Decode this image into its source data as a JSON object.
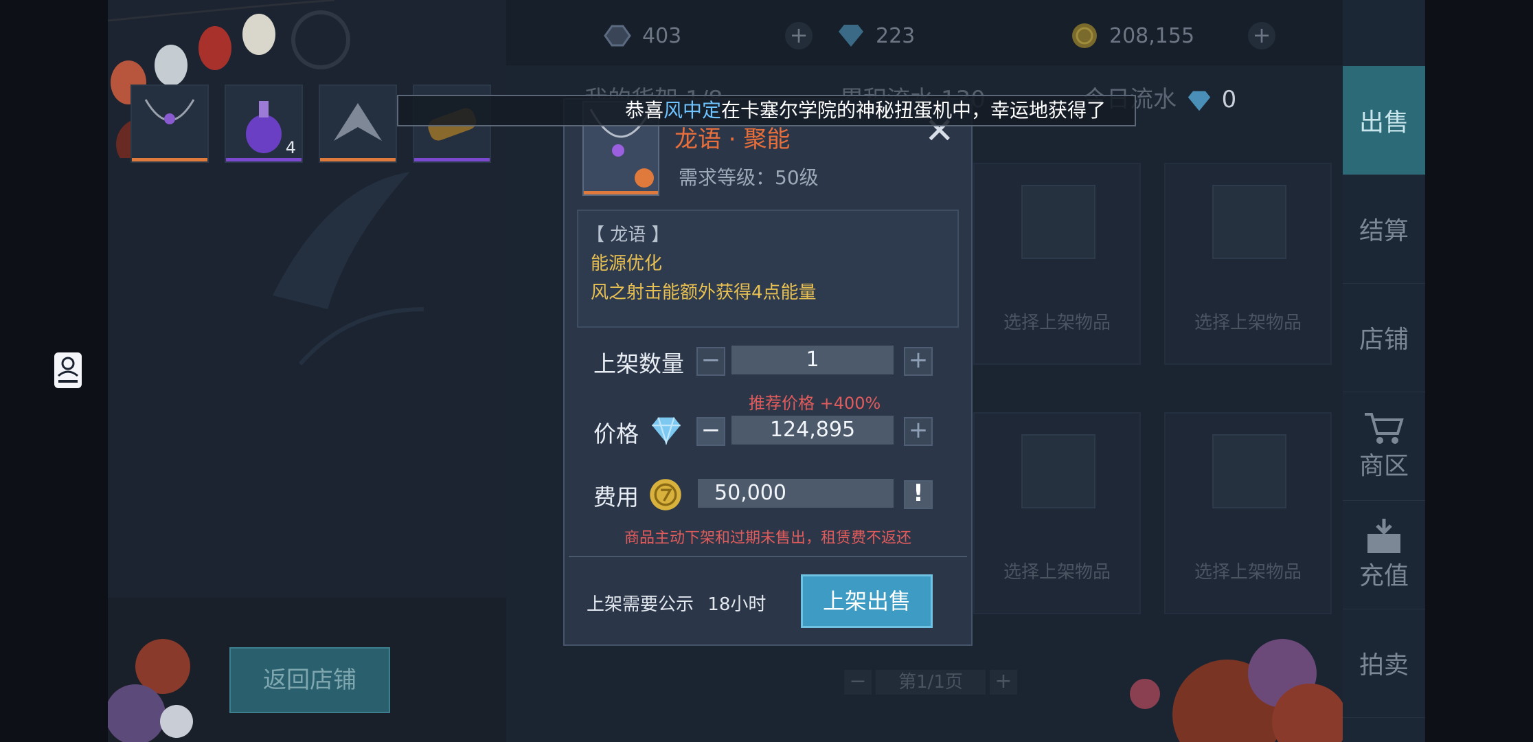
{
  "currencies": {
    "crystal_value": "403",
    "diamond_value": "223",
    "gold_value": "208,155"
  },
  "stall_header": {
    "shelf_label": "我的货架",
    "shelf_count": "1/8",
    "total_flow_label": "累积流水",
    "total_flow_value": "130",
    "today_flow_label": "今日流水",
    "today_flow_value": "0"
  },
  "broadcast": {
    "prefix": "恭喜",
    "player": "风中定",
    "suffix": "在卡塞尔学院的神秘扭蛋机中，幸运地获得了"
  },
  "inventory": {
    "items": [
      {
        "name": "necklace",
        "count": ""
      },
      {
        "name": "potion",
        "count": "4"
      },
      {
        "name": "wing-crest",
        "count": ""
      },
      {
        "name": "scroll",
        "count": ""
      }
    ],
    "return_button": "返回店铺"
  },
  "slots": {
    "placeholder": "选择上架物品"
  },
  "pagination": {
    "page_label": "第1/1页"
  },
  "side_tabs": [
    {
      "label": "出售",
      "active": true
    },
    {
      "label": "结算",
      "active": false
    },
    {
      "label": "店铺",
      "active": false
    },
    {
      "label": "商区",
      "active": false
    },
    {
      "label": "充值",
      "active": false
    },
    {
      "label": "拍卖",
      "active": false
    }
  ],
  "dialog": {
    "item_name": "龙语 · 聚能",
    "required_level": "需求等级：50级",
    "desc_tag": "【 龙语 】",
    "desc_line1": "能源优化",
    "desc_line2": "风之射击能额外获得4点能量",
    "quantity_label": "上架数量",
    "quantity_value": "1",
    "recommend_price": "推荐价格 +400%",
    "price_label": "价格",
    "price_value": "124,895",
    "fee_label": "费用",
    "fee_value": "50,000",
    "fee_warning": "商品主动下架和过期未售出，租赁费不返还",
    "publicity_label": "上架需要公示",
    "publicity_time": "18小时",
    "sell_button": "上架出售",
    "minus": "−",
    "plus": "+",
    "info": "!"
  },
  "colors": {
    "item_name": "#e86f3b",
    "player_name": "#6fc3ff",
    "desc_yellow": "#e8c052",
    "warning_red": "#e05b5b",
    "sell_button": "#3e9cc4"
  }
}
